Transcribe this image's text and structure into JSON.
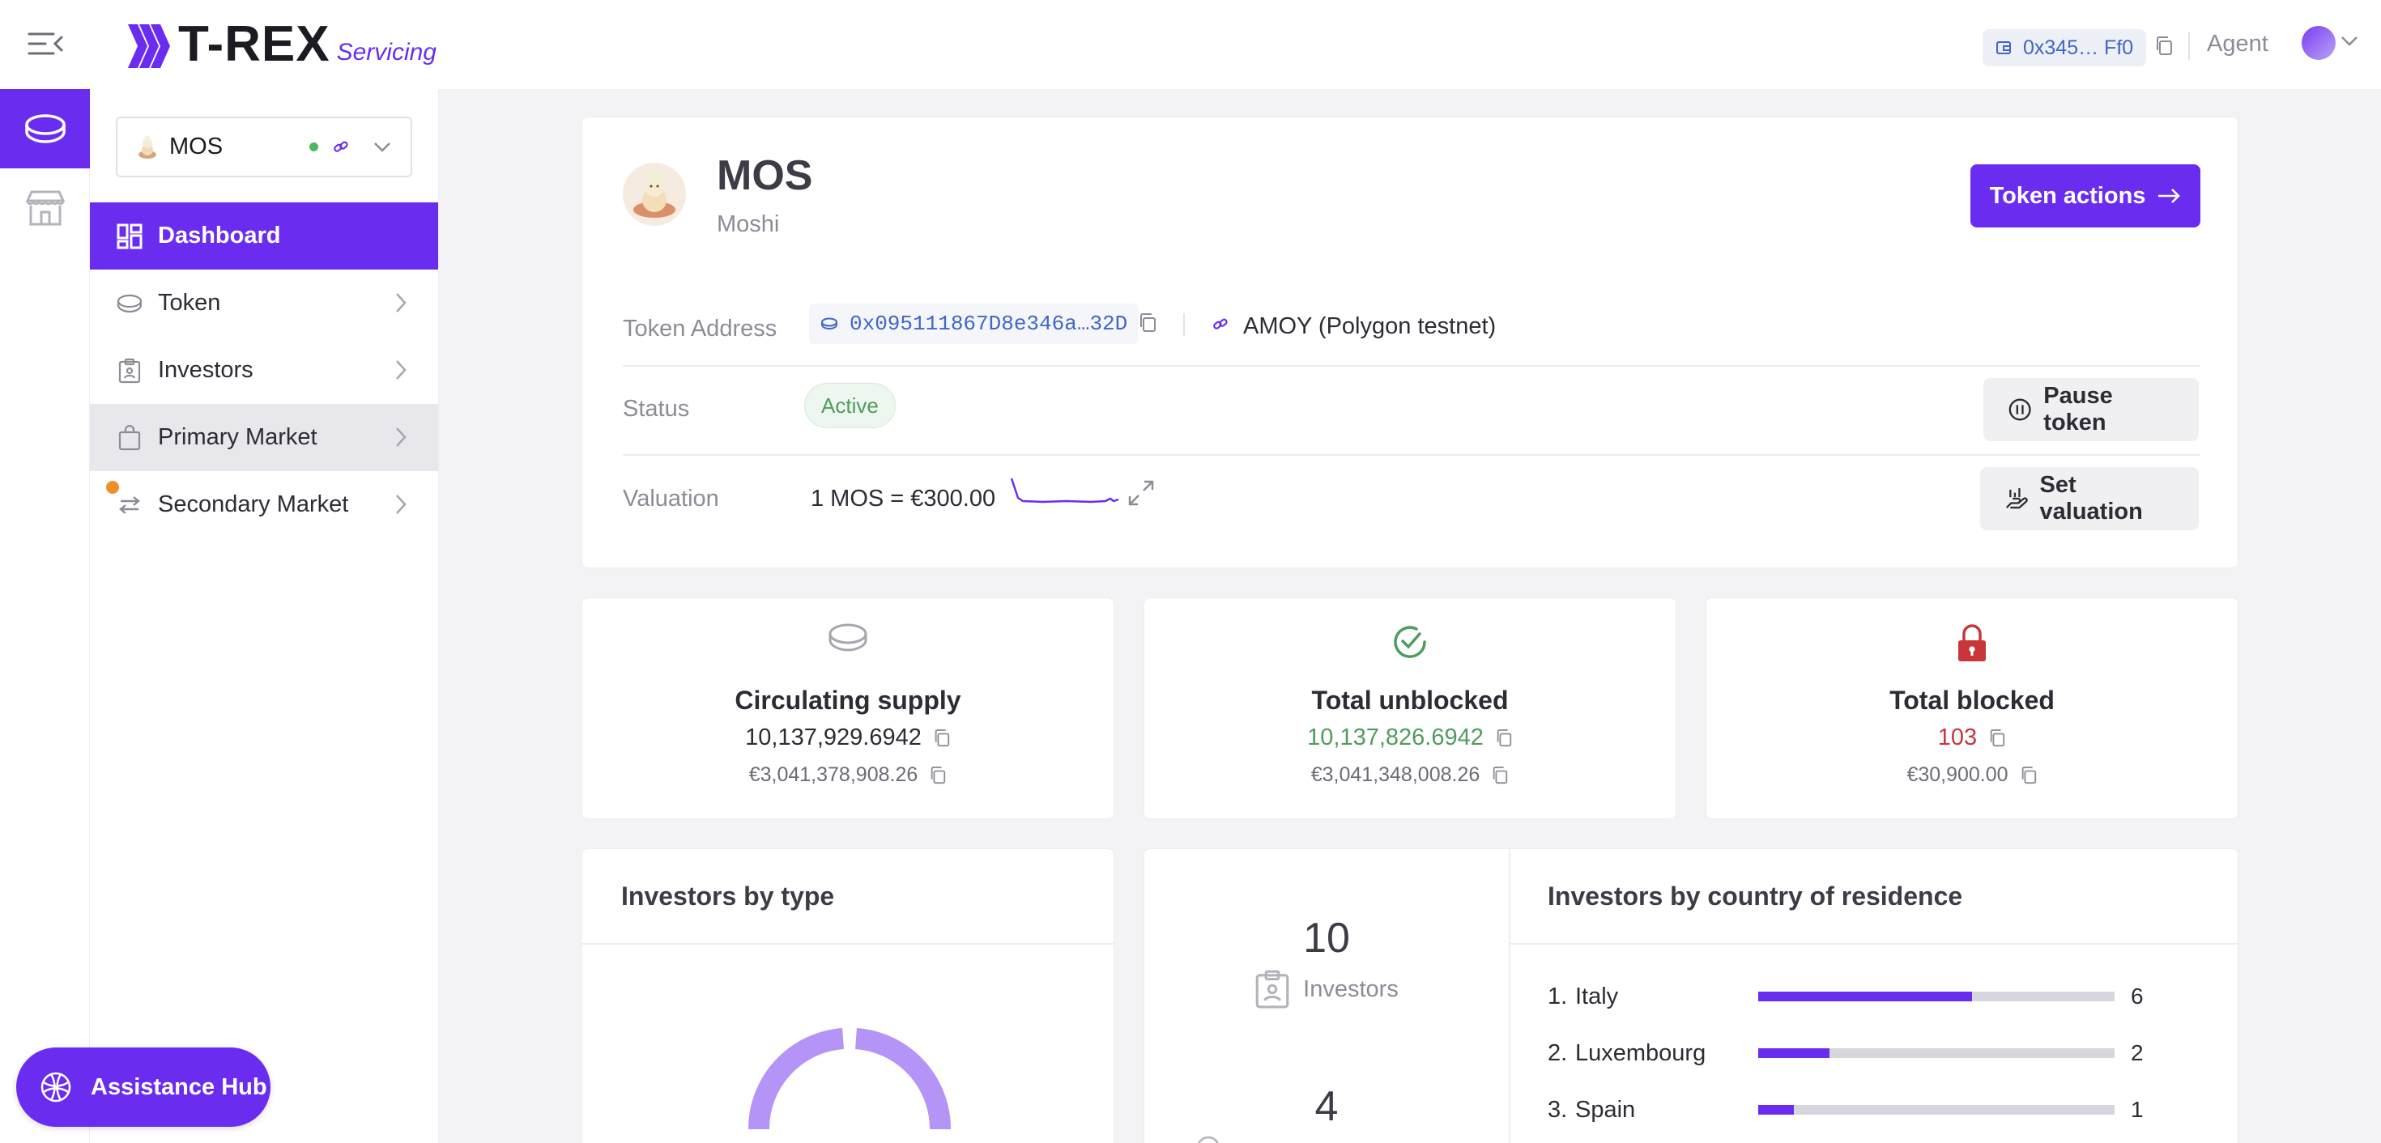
{
  "header": {
    "logo_text": "T-REX",
    "logo_sub": "Servicing",
    "wallet_address": "0x345… Ff0",
    "role": "Agent"
  },
  "sidebar": {
    "token_selector": {
      "name": "MOS"
    },
    "items": [
      {
        "label": "Dashboard",
        "icon": "dashboard-icon"
      },
      {
        "label": "Token",
        "icon": "coin-icon"
      },
      {
        "label": "Investors",
        "icon": "clipboard-icon"
      },
      {
        "label": "Primary Market",
        "icon": "bag-icon"
      },
      {
        "label": "Secondary Market",
        "icon": "swap-icon"
      }
    ],
    "assistance": "Assistance Hub"
  },
  "token": {
    "symbol": "MOS",
    "name": "Moshi",
    "actions_label": "Token actions",
    "address_label": "Token Address",
    "address": "0x095111867D8e346a…32D",
    "network": "AMOY (Polygon testnet)",
    "status_label": "Status",
    "status": "Active",
    "pause_label": "Pause token",
    "valuation_label": "Valuation",
    "valuation": "1 MOS = €300.00",
    "set_valuation_label": "Set valuation"
  },
  "stats": [
    {
      "title": "Circulating supply",
      "value": "10,137,929.6942",
      "fiat": "€3,041,378,908.26",
      "color": "#2c2c35"
    },
    {
      "title": "Total unblocked",
      "value": "10,137,826.6942",
      "fiat": "€3,041,348,008.26",
      "color": "#4f9c5c"
    },
    {
      "title": "Total blocked",
      "value": "103",
      "fiat": "€30,900.00",
      "color": "#c8363c"
    }
  ],
  "investors_by_type": {
    "title": "Investors by type"
  },
  "investor_counts": [
    {
      "value": "10",
      "label": "Investors"
    },
    {
      "value": "4",
      "label": ""
    }
  ],
  "investors_by_country": {
    "title": "Investors by country of residence",
    "rows": [
      {
        "rank": "1.",
        "country": "Italy",
        "count": "6",
        "fraction": 0.6
      },
      {
        "rank": "2.",
        "country": "Luxembourg",
        "count": "2",
        "fraction": 0.2
      },
      {
        "rank": "3.",
        "country": "Spain",
        "count": "1",
        "fraction": 0.1
      }
    ]
  },
  "colors": {
    "accent": "#6a2df0",
    "success": "#4f9c5c",
    "danger": "#c8363c"
  }
}
